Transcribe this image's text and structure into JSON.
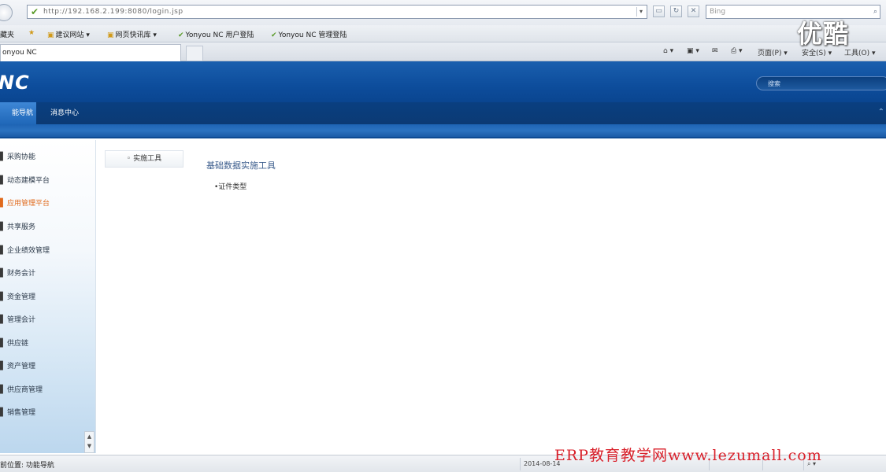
{
  "browser": {
    "url": "http://192.168.2.199:8080/login.jsp",
    "search_placeholder": "Bing",
    "favorites_label": "藏夹",
    "favorites": [
      {
        "label": "建议网站 ▾",
        "icon": "ie-page-icon"
      },
      {
        "label": "网页快讯库 ▾",
        "icon": "ie-page-icon"
      },
      {
        "label": "Yonyou NC 用户登陆",
        "icon": "yonyou-icon"
      },
      {
        "label": "Yonyou NC 管理登陆",
        "icon": "yonyou-icon"
      }
    ],
    "tab_title": "onyou NC",
    "commands": {
      "page": "页面(P) ▾",
      "safety": "安全(S) ▾",
      "tools": "工具(O) ▾"
    }
  },
  "app": {
    "logo": "NC",
    "search_placeholder": "搜索",
    "nav": {
      "active_tab": "能导航",
      "message_tab": "消息中心"
    }
  },
  "sidebar": {
    "items": [
      {
        "label": "采购协能"
      },
      {
        "label": "动态建模平台"
      },
      {
        "label": "应用管理平台"
      },
      {
        "label": "共享服务"
      },
      {
        "label": "企业绩效管理"
      },
      {
        "label": "财务会计"
      },
      {
        "label": "资金管理"
      },
      {
        "label": "管理会计"
      },
      {
        "label": "供应链"
      },
      {
        "label": "资产管理"
      },
      {
        "label": "供应商管理"
      },
      {
        "label": "销售管理"
      }
    ],
    "selected_index": 2
  },
  "main": {
    "tool_button": "实施工具",
    "title": "基础数据实施工具",
    "link": "•证件类型"
  },
  "status": {
    "left": "前位置: 功能导航",
    "date": "2014-08-14"
  },
  "watermarks": {
    "top": "优酷",
    "bottom": "ERP教育教学网www.lezumall.com"
  }
}
